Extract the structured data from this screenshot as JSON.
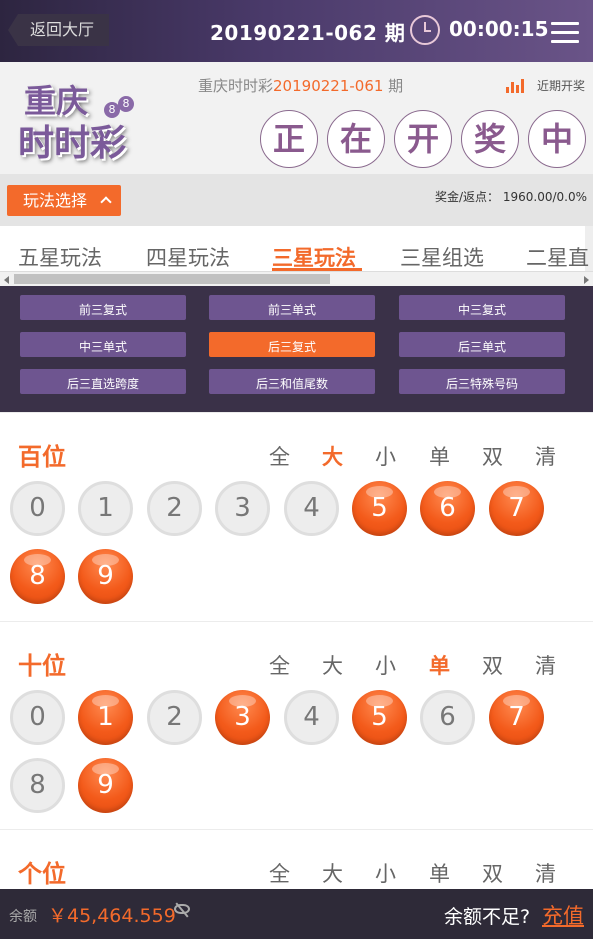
{
  "header": {
    "back_label": "返回大厅",
    "issue": "20190221-062 期",
    "countdown": "00:00:15"
  },
  "lottery": {
    "logo_line1": "重庆",
    "logo_line2": "时时彩",
    "logo_ball1": "8",
    "logo_ball2": "8",
    "last_prefix": "重庆时时彩",
    "last_issue": "20190221-061",
    "last_suffix": " 期",
    "recent_label": "近期开奖",
    "draw_chars": [
      "正",
      "在",
      "开",
      "奖",
      "中"
    ]
  },
  "play": {
    "select_label": "玩法选择",
    "bonus": "奖金/返点： 1960.00/0.0%"
  },
  "tabs": [
    "五星玩法",
    "四星玩法",
    "三星玩法",
    "三星组选",
    "二星直"
  ],
  "sub_plays": [
    "前三复式",
    "前三单式",
    "中三复式",
    "中三单式",
    "后三复式",
    "后三单式",
    "后三直选跨度",
    "后三和值尾数",
    "后三特殊号码"
  ],
  "quick_labels": [
    "全",
    "大",
    "小",
    "单",
    "双",
    "清"
  ],
  "digits": [
    {
      "label": "百位",
      "active_quick": 1,
      "selected": [
        5,
        6,
        7,
        8,
        9
      ]
    },
    {
      "label": "十位",
      "active_quick": 3,
      "selected": [
        1,
        3,
        5,
        7,
        9
      ]
    },
    {
      "label": "个位",
      "active_quick": -1,
      "selected": []
    }
  ],
  "bottom": {
    "balance_label": "余额",
    "balance_value": "￥45,464.559",
    "insufficient": "余额不足?",
    "recharge": "充值"
  },
  "colors": {
    "accent": "#f36a2b",
    "header_bg": "#4a3a6a",
    "sub_play_bg": "#3a3148",
    "sub_btn": "#6e5590"
  }
}
